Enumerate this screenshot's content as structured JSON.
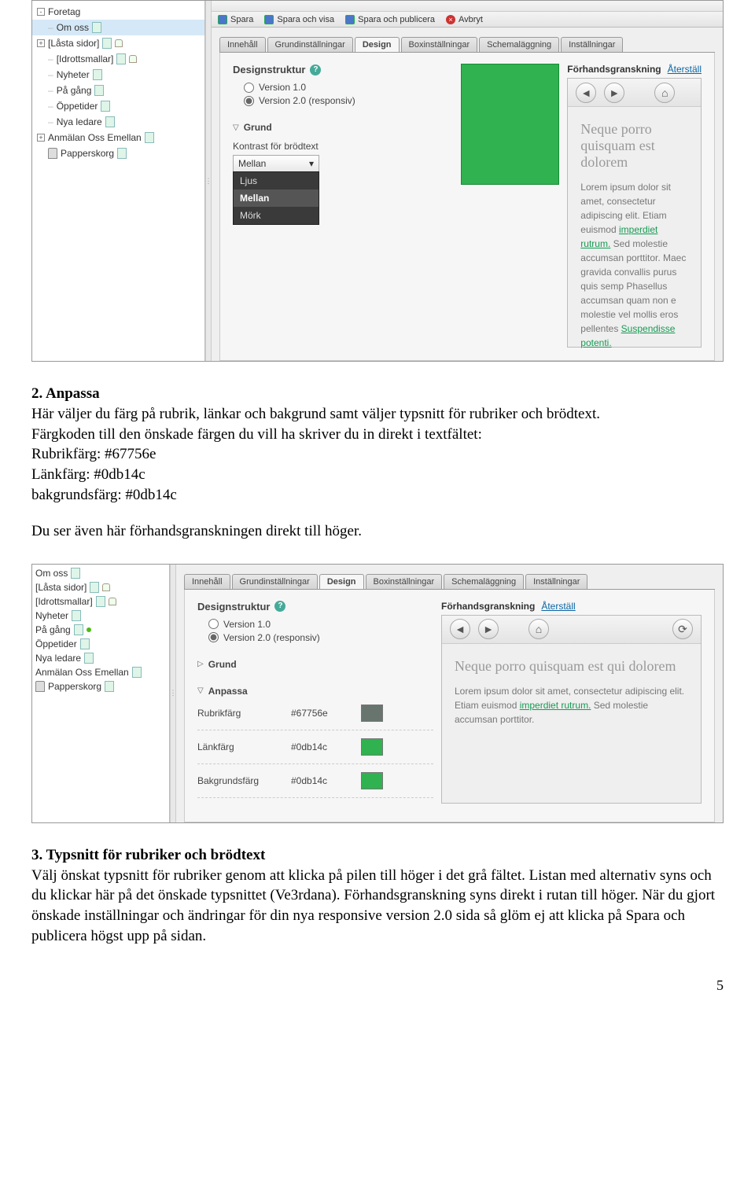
{
  "top_toolbar": {
    "save": "Spara",
    "save_show": "Spara och visa",
    "save_publish": "Spara och publicera",
    "cancel": "Avbryt"
  },
  "sidebar1": {
    "items": [
      {
        "expand": "-",
        "label": "Foretag",
        "icon": "none",
        "lock": false
      },
      {
        "expand": "",
        "label": "Om oss",
        "icon": "page",
        "lock": false
      },
      {
        "expand": "+",
        "label": "[Låsta sidor]",
        "icon": "page",
        "lock": true
      },
      {
        "expand": "-",
        "label": "[Idrottsmallar]",
        "icon": "page",
        "lock": true
      },
      {
        "expand": "-",
        "label": "Nyheter",
        "icon": "page",
        "lock": false
      },
      {
        "expand": "-",
        "label": "På gång",
        "icon": "page",
        "lock": false
      },
      {
        "expand": "-",
        "label": "Öppetider",
        "icon": "page",
        "lock": false
      },
      {
        "expand": "-",
        "label": "Nya ledare",
        "icon": "page",
        "lock": false
      },
      {
        "expand": "+",
        "label": "Anmälan Oss Emellan",
        "icon": "page",
        "lock": false
      },
      {
        "expand": "",
        "label": "Papperskorg",
        "icon": "trash",
        "lock": false
      }
    ]
  },
  "tabs": {
    "items": [
      "Innehåll",
      "Grundinställningar",
      "Design",
      "Boxinställningar",
      "Schemaläggning",
      "Inställningar"
    ],
    "active": "Design"
  },
  "designstruct": {
    "title": "Designstruktur",
    "v1": "Version 1.0",
    "v2": "Version 2.0 (responsiv)"
  },
  "grund": {
    "title": "Grund",
    "kontrast_label": "Kontrast för brödtext",
    "kontrast_selected": "Mellan",
    "options": [
      "Ljus",
      "Mellan",
      "Mörk"
    ]
  },
  "preview": {
    "title": "Förhandsgranskning",
    "reset": "Återställ",
    "h": "Neque porro quisquam est dolorem",
    "body1": "Lorem ipsum dolor sit amet, consectetur adipiscing elit. Etiam euismod ",
    "link1": "imperdiet rutrum.",
    "body2": " Sed molestie accumsan porttitor. Maec gravida convallis purus quis semp Phasellus accumsan quam non e molestie vel mollis eros pellentes ",
    "link2": "Suspendisse potenti."
  },
  "doc": {
    "s2_title": "2. Anpassa",
    "s2_p1": "Här väljer du färg på rubrik, länkar och bakgrund samt väljer typsnitt för rubriker och brödtext.",
    "s2_p2": "Färgkoden till den önskade färgen du vill ha skriver du in direkt i textfältet:",
    "s2_r": "Rubrikfärg: #67756e",
    "s2_l": "Länkfärg: #0db14c",
    "s2_b": "bakgrundsfärg: #0db14c",
    "s2_p3": "Du ser även här förhandsgranskningen direkt till höger.",
    "s3_title": "3. Typsnitt för rubriker och brödtext",
    "s3_p": "Välj önskat typsnitt för rubriker genom att klicka på pilen till höger i det grå fältet. Listan med alternativ syns och du klickar här på det önskade typsnittet (Ve3rdana). Förhandsgranskning syns direkt i rutan till höger. När du gjort önskade inställningar och ändringar för din nya responsive version 2.0 sida så glöm ej att klicka på Spara och publicera högst upp på sidan."
  },
  "sidebar2": {
    "items": [
      {
        "label": "Om oss",
        "icon": "page"
      },
      {
        "label": "[Låsta sidor]",
        "icon": "page",
        "lock": true
      },
      {
        "label": "[Idrottsmallar]",
        "icon": "page",
        "lock": true
      },
      {
        "label": "Nyheter",
        "icon": "page"
      },
      {
        "label": "På gång",
        "icon": "page"
      },
      {
        "label": "Öppetider",
        "icon": "page"
      },
      {
        "label": "Nya ledare",
        "icon": "page"
      },
      {
        "label": "Anmälan Oss Emellan",
        "icon": "page"
      },
      {
        "label": "Papperskorg",
        "icon": "trash"
      }
    ]
  },
  "anpassa": {
    "title": "Anpassa",
    "rows": [
      {
        "label": "Rubrikfärg",
        "value": "#67756e",
        "swatch": "#67756e"
      },
      {
        "label": "Länkfärg",
        "value": "#0db14c",
        "swatch": "#2fb24f"
      },
      {
        "label": "Bakgrundsfärg",
        "value": "#0db14c",
        "swatch": "#2fb24f"
      }
    ]
  },
  "preview2": {
    "h": "Neque porro quisquam est qui dolorem",
    "body1": "Lorem ipsum dolor sit amet, consectetur adipiscing elit. Etiam euismod ",
    "link1": "imperdiet rutrum.",
    "body2": " Sed molestie accumsan porttitor."
  },
  "pagenum": "5"
}
